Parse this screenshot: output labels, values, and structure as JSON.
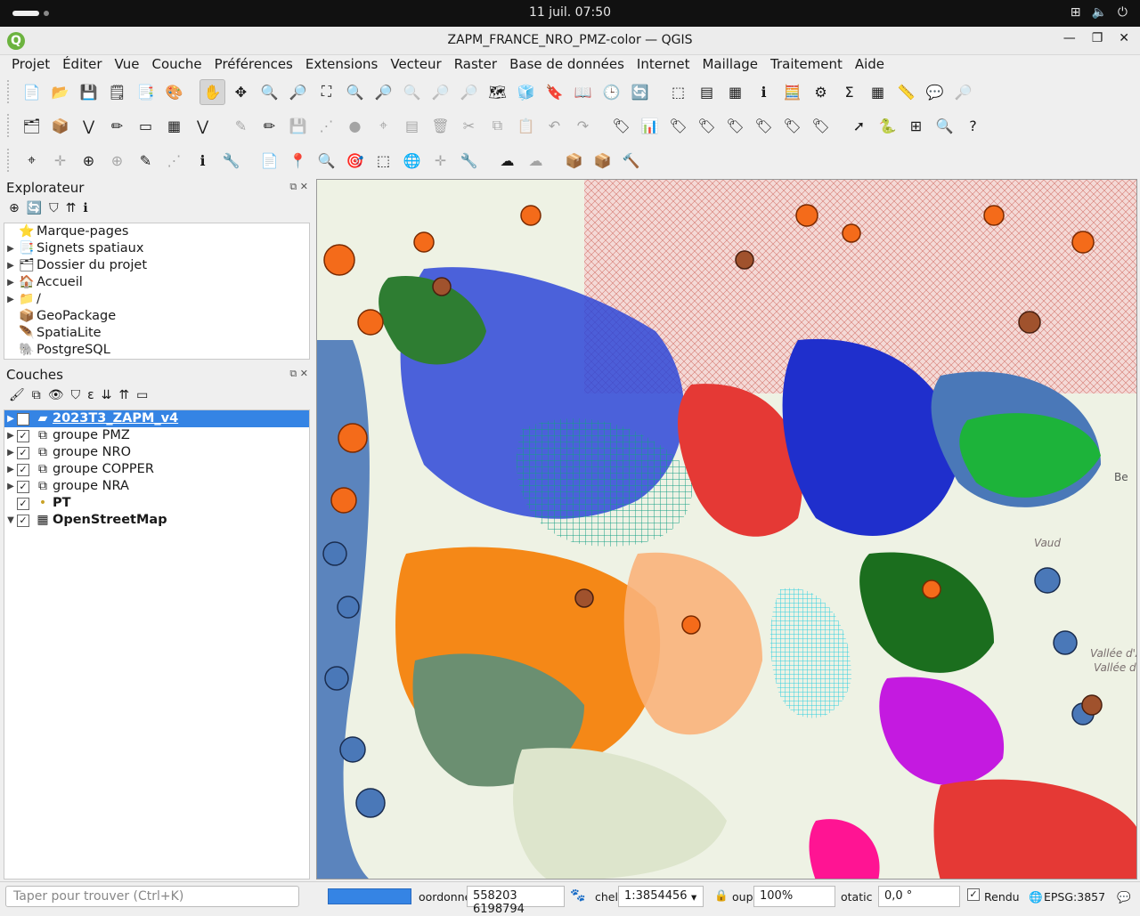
{
  "system": {
    "date_time": "11 juil.  07:50"
  },
  "window": {
    "title": "ZAPM_FRANCE_NRO_PMZ-color — QGIS"
  },
  "menu": [
    "Projet",
    "Éditer",
    "Vue",
    "Couche",
    "Préférences",
    "Extensions",
    "Vecteur",
    "Raster",
    "Base de données",
    "Internet",
    "Maillage",
    "Traitement",
    "Aide"
  ],
  "explorer": {
    "title": "Explorateur",
    "items": [
      {
        "label": "Marque-pages",
        "icon": "star-icon",
        "expandable": false
      },
      {
        "label": "Signets spatiaux",
        "icon": "bookmark-icon",
        "expandable": true
      },
      {
        "label": "Dossier du projet",
        "icon": "project-folder-icon",
        "expandable": true
      },
      {
        "label": "Accueil",
        "icon": "home-folder-icon",
        "expandable": true
      },
      {
        "label": "/",
        "icon": "folder-icon",
        "expandable": true
      },
      {
        "label": "GeoPackage",
        "icon": "geopackage-icon",
        "expandable": false
      },
      {
        "label": "SpatiaLite",
        "icon": "spatialite-icon",
        "expandable": false
      },
      {
        "label": "PostgreSQL",
        "icon": "postgresql-icon",
        "expandable": false
      }
    ]
  },
  "layers": {
    "title": "Couches",
    "items": [
      {
        "label": "2023T3_ZAPM_v4",
        "checked": true,
        "selected": true,
        "bold": true
      },
      {
        "label": "groupe PMZ",
        "checked": true,
        "selected": false,
        "bold": false
      },
      {
        "label": "groupe NRO",
        "checked": true,
        "selected": false,
        "bold": false
      },
      {
        "label": "groupe COPPER",
        "checked": true,
        "selected": false,
        "bold": false
      },
      {
        "label": "groupe NRA",
        "checked": true,
        "selected": false,
        "bold": false
      },
      {
        "label": "PT",
        "checked": true,
        "selected": false,
        "bold": true
      },
      {
        "label": "OpenStreetMap",
        "checked": true,
        "selected": false,
        "bold": true
      }
    ]
  },
  "map_labels": [
    "Vaud",
    "Be",
    "Vallée d'A",
    "Vallée de"
  ],
  "statusbar": {
    "search_placeholder": "Taper pour trouver (Ctrl+K)",
    "coord_label": "oordonné",
    "coordinate": "558203  6198794",
    "scale_label": "chel",
    "scale": "1:3854456",
    "magnifier_label": "oup",
    "magnifier": "100%",
    "rotation_label": "otatic",
    "rotation": "0,0 °",
    "render_label": "Rendu",
    "crs": "EPSG:3857"
  }
}
